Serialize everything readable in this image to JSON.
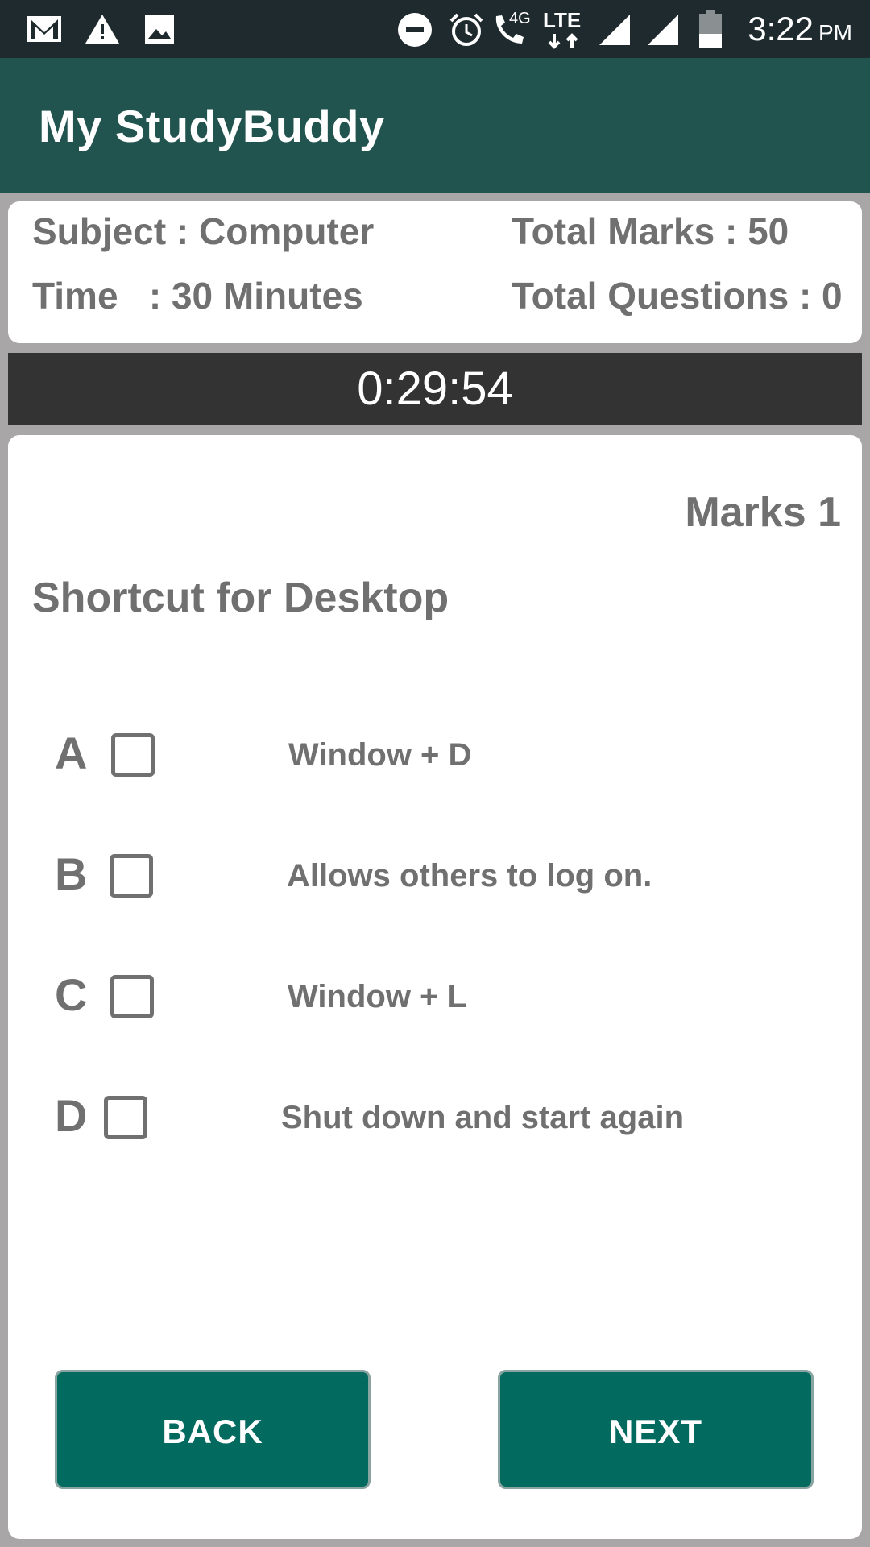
{
  "status_bar": {
    "time": "3:22",
    "ampm": "PM",
    "icons": [
      "gmail-icon",
      "warning-icon",
      "image-icon",
      "do-not-disturb-icon",
      "alarm-icon",
      "wifi-call-icon",
      "lte-icon",
      "signal-icon",
      "signal-icon",
      "battery-icon"
    ],
    "network_label": "4G",
    "lte_label": "LTE"
  },
  "app_bar": {
    "title": "My StudyBuddy"
  },
  "info": {
    "subject": "Subject : Computer",
    "time": "Time   : 30 Minutes",
    "total_marks": "Total Marks : 50",
    "total_questions": "Total Questions : 0"
  },
  "timer": "0:29:54",
  "question": {
    "marks": "Marks 1",
    "text": "Shortcut for Desktop",
    "options": [
      {
        "letter": "A",
        "text": "Window + D",
        "checked": false
      },
      {
        "letter": "B",
        "text": "Allows others to log on.",
        "checked": false
      },
      {
        "letter": "C",
        "text": "Window + L",
        "checked": false
      },
      {
        "letter": "D",
        "text": "Shut down and start again",
        "checked": false
      }
    ]
  },
  "buttons": {
    "back": "BACK",
    "next": "NEXT"
  },
  "colors": {
    "app_bar": "#21534f",
    "status_bar": "#1f2a2e",
    "button": "#036a60",
    "timer_bg": "#333333",
    "text_gray": "#707070"
  }
}
